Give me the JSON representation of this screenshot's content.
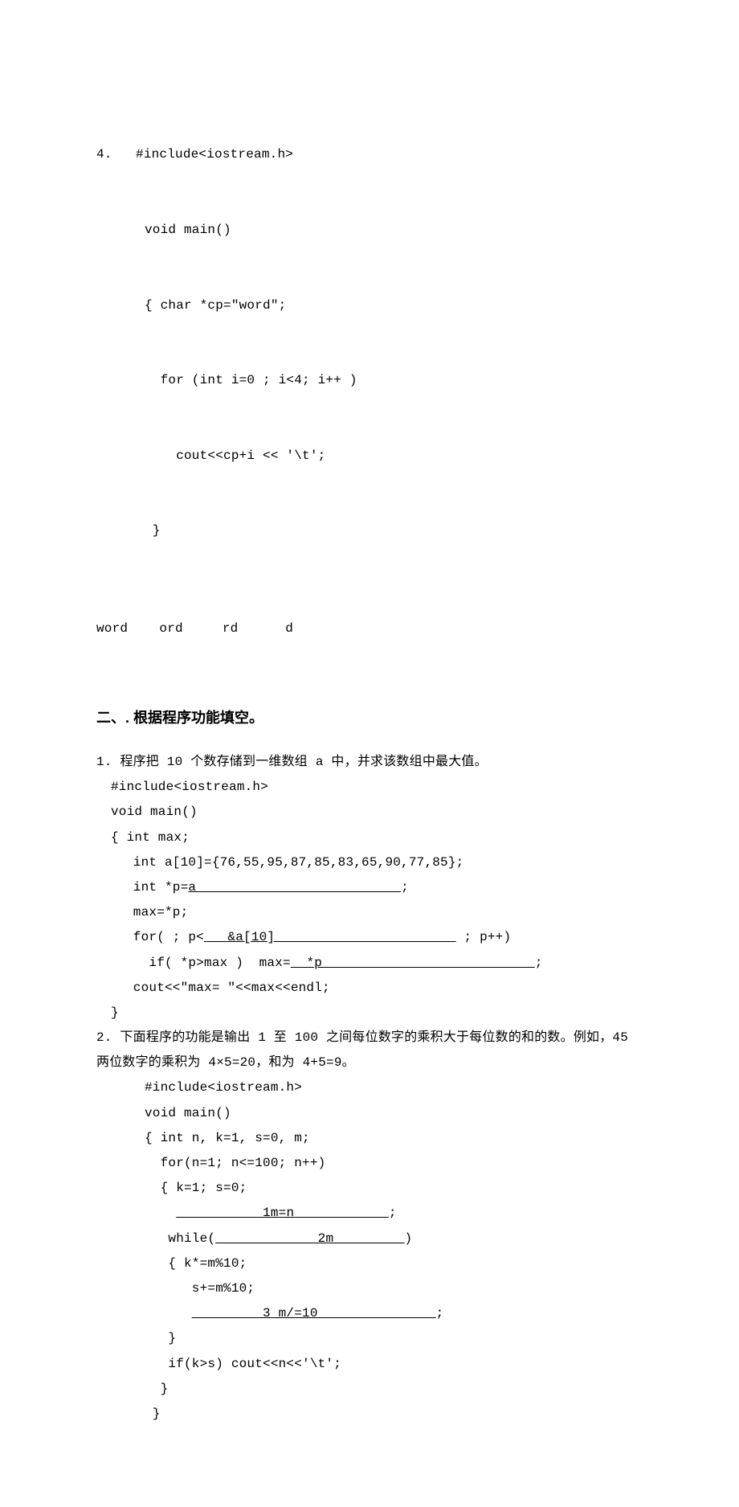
{
  "block1": {
    "num": "4.",
    "l1": "#include<iostream.h>",
    "l2": "void main()",
    "l3": "{ char *cp=\"word\";",
    "l4": "  for (int i=0 ; i<4; i++ )",
    "l5": "    cout<<cp+i << '\\t';",
    "l6": " }",
    "output": "word    ord     rd      d"
  },
  "section2": {
    "title": "二、. 根据程序功能填空。"
  },
  "q1": {
    "desc": "1. 程序把 10 个数存储到一维数组 a 中，并求该数组中最大值。",
    "l1": "#include<iostream.h>",
    "l2": "void main()",
    "l3": "{ int max;",
    "l4": " int a[10]={76,55,95,87,85,83,65,90,77,85};",
    "l5a": " int *p=",
    "l5u": "a                          ",
    "l5b": ";",
    "l6": " max=*p;",
    "l7a": " for( ; p<",
    "l7u": "   &a[10]                       ",
    "l7b": " ; p++)",
    "l8a": "   if( *p>max )  max=",
    "l8u": "  *p                           ",
    "l8b": ";",
    "l9": " cout<<\"max= \"<<max<<endl;",
    "l10": "}"
  },
  "q2": {
    "desc1": "2. 下面程序的功能是输出 1 至 100 之间每位数字的乘积大于每位数的和的数。例如，45 两位数字的乘积为 4×5=20，和为 4+5=9。",
    "l1": "#include<iostream.h>",
    "l2": "void main()",
    "l3": "{ int n, k=1, s=0, m;",
    "l4": "  for(n=1; n<=100; n++)",
    "l5": "  { k=1; s=0;",
    "l6a": "    ",
    "l6u": "           1m=n            ",
    "l6b": ";",
    "l7a": "   while(",
    "l7u": "             2m         ",
    "l7b": ")",
    "l8": "   { k*=m%10;",
    "l9": "      s+=m%10;",
    "l10a": "      ",
    "l10u": "         3 m/=10               ",
    "l10b": ";",
    "l11": "   }",
    "l12": "   if(k>s) cout<<n<<'\\t';",
    "l13": "  }",
    "l14": " }"
  }
}
